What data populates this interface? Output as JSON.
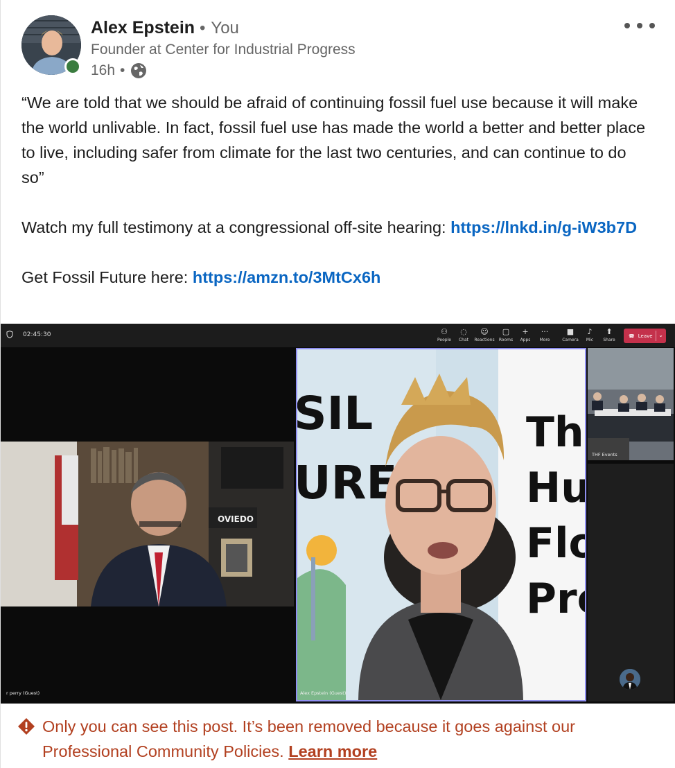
{
  "post": {
    "author_name": "Alex Epstein",
    "author_relation": "You",
    "author_headline": "Founder at Center for Industrial Progress",
    "timestamp": "16h",
    "visibility_icon": "globe-icon",
    "more_icon": "more-horizontal-icon",
    "body": {
      "quote": "“We are told that we should be afraid of continuing fossil fuel use because it will make the world unlivable. In fact, fossil fuel use has made the world a better and better place to live, including safer from climate for the last two centuries, and can continue to do so”",
      "testimony_text": "Watch my full testimony at a congressional off-site hearing: ",
      "testimony_link": "https://lnkd.in/g-iW3b7D",
      "book_text": "Get Fossil Future here: ",
      "book_link": "https://amzn.to/3MtCx6h"
    }
  },
  "video": {
    "timer": "02:45:30",
    "toolbar": [
      {
        "label": "People",
        "icon": "people-icon"
      },
      {
        "label": "Chat",
        "icon": "chat-icon"
      },
      {
        "label": "Reactions",
        "icon": "reactions-icon"
      },
      {
        "label": "Rooms",
        "icon": "rooms-icon"
      },
      {
        "label": "Apps",
        "icon": "plus-icon"
      },
      {
        "label": "More",
        "icon": "more-icon"
      },
      {
        "label": "Camera",
        "icon": "camera-icon"
      },
      {
        "label": "Mic",
        "icon": "mic-icon"
      },
      {
        "label": "Share",
        "icon": "share-icon"
      }
    ],
    "leave_label": "Leave",
    "participants": {
      "left_name": "r perry (Guest)",
      "main_name": "Alex Epstein (Guest)",
      "gallery_name": "THF Events"
    },
    "backdrop_text": {
      "banner_left": [
        "SIL",
        "URE"
      ],
      "banner_right": [
        "Th",
        "Hu",
        "Flo",
        "Pro"
      ],
      "desk_sign": "OVIEDO"
    }
  },
  "notice": {
    "icon": "warning-icon",
    "text": "Only you can see this post. It’s been removed because it goes against our Professional Community Policies. ",
    "link": "Learn more",
    "color": "#b24020"
  },
  "colors": {
    "link": "#0a66c2",
    "online": "#3a7c3f",
    "leave": "#c4314b",
    "active_speaker_border": "#8f8ff0"
  }
}
